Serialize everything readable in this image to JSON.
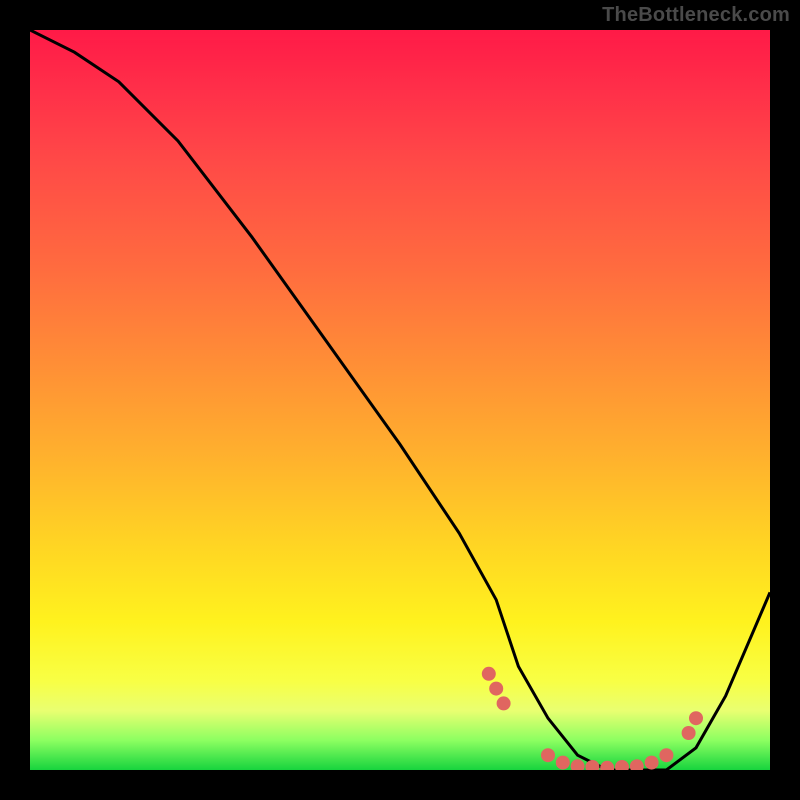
{
  "watermark": "TheBottleneck.com",
  "chart_data": {
    "type": "line",
    "title": "",
    "xlabel": "",
    "ylabel": "",
    "xlim": [
      0,
      100
    ],
    "ylim": [
      0,
      100
    ],
    "series": [
      {
        "name": "bottleneck-curve",
        "x": [
          0,
          6,
          12,
          20,
          30,
          40,
          50,
          58,
          63,
          66,
          70,
          74,
          78,
          82,
          86,
          90,
          94,
          100
        ],
        "y": [
          100,
          97,
          93,
          85,
          72,
          58,
          44,
          32,
          23,
          14,
          7,
          2,
          0,
          0,
          0,
          3,
          10,
          24
        ]
      }
    ],
    "markers": {
      "name": "highlight-dots",
      "color": "#e06660",
      "points": [
        {
          "x": 62,
          "y": 13
        },
        {
          "x": 63,
          "y": 11
        },
        {
          "x": 64,
          "y": 9
        },
        {
          "x": 70,
          "y": 2
        },
        {
          "x": 72,
          "y": 1
        },
        {
          "x": 74,
          "y": 0.5
        },
        {
          "x": 76,
          "y": 0.4
        },
        {
          "x": 78,
          "y": 0.3
        },
        {
          "x": 80,
          "y": 0.4
        },
        {
          "x": 82,
          "y": 0.5
        },
        {
          "x": 84,
          "y": 1
        },
        {
          "x": 86,
          "y": 2
        },
        {
          "x": 89,
          "y": 5
        },
        {
          "x": 90,
          "y": 7
        }
      ]
    },
    "gradient_stops": [
      {
        "pos": 0.0,
        "color": "#ff1a47"
      },
      {
        "pos": 0.5,
        "color": "#ffb22d"
      },
      {
        "pos": 0.8,
        "color": "#fff21e"
      },
      {
        "pos": 0.95,
        "color": "#8cff61"
      },
      {
        "pos": 1.0,
        "color": "#17d43e"
      }
    ]
  }
}
